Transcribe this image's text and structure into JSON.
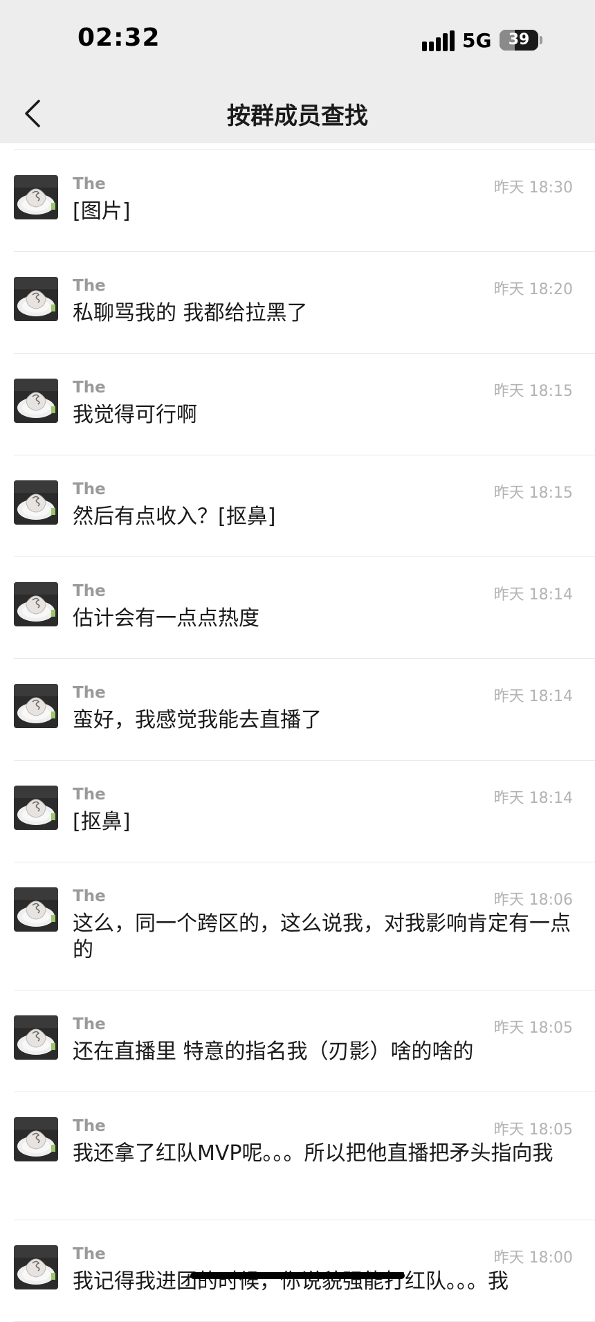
{
  "status_bar": {
    "time": "02:32",
    "network": "5G",
    "battery": "39",
    "battery_level": 0.39,
    "icons": [
      "signal-icon",
      "battery-icon"
    ]
  },
  "nav": {
    "title": "按群成员查找",
    "back_icon": "chevron-left-icon"
  },
  "messages": [
    {
      "sender": "The",
      "time": "昨天 18:30",
      "text": "[图片]"
    },
    {
      "sender": "The",
      "time": "昨天 18:20",
      "text": "私聊骂我的 我都给拉黑了"
    },
    {
      "sender": "The",
      "time": "昨天 18:15",
      "text": "我觉得可行啊"
    },
    {
      "sender": "The",
      "time": "昨天 18:15",
      "text": "然后有点收入？[抠鼻]"
    },
    {
      "sender": "The",
      "time": "昨天 18:14",
      "text": "估计会有一点点热度"
    },
    {
      "sender": "The",
      "time": "昨天 18:14",
      "text": "蛮好，我感觉我能去直播了"
    },
    {
      "sender": "The",
      "time": "昨天 18:14",
      "text": "[抠鼻]"
    },
    {
      "sender": "The",
      "time": "昨天 18:06",
      "text": "这么，同一个跨区的，这么说我，对我影响肯定有一点的"
    },
    {
      "sender": "The",
      "time": "昨天 18:05",
      "text": "还在直播里 特意的指名我（刃影）啥的啥的"
    },
    {
      "sender": "The",
      "time": "昨天 18:05",
      "text": "我还拿了红队MVP呢。。。所以把他直播把矛头指向我"
    },
    {
      "sender": "The",
      "time": "昨天 18:00",
      "text": "我记得我进团的时候，你说貌强能打红队。。。我"
    }
  ],
  "colors": {
    "header_bg": "#ededed",
    "text_primary": "#1a1a1a",
    "text_secondary": "#9a9a9a"
  }
}
